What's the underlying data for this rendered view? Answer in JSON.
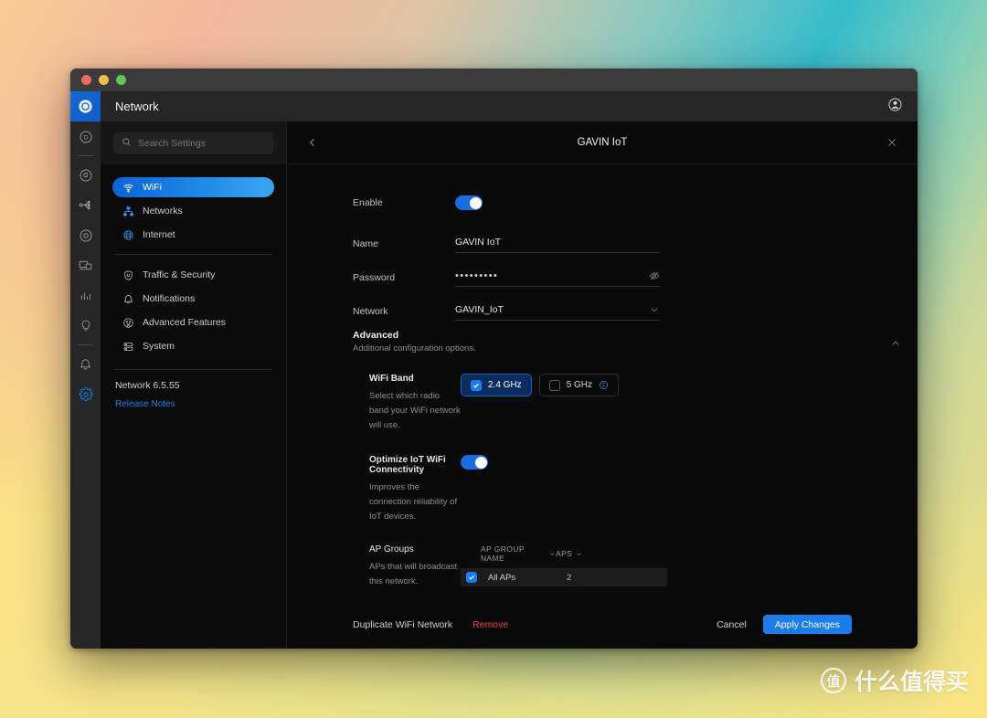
{
  "desktop": {
    "watermark_badge": "值",
    "watermark_text": "什么值得买"
  },
  "window": {
    "traffic_lights": [
      "close",
      "minimize",
      "maximize"
    ],
    "app_title": "Network"
  },
  "rail": {
    "items": [
      {
        "name": "unifi-logo",
        "label": "UniFi"
      },
      {
        "name": "console-d",
        "label": "D"
      },
      {
        "name": "divider-1",
        "label": ""
      },
      {
        "name": "network-app",
        "label": "Network"
      },
      {
        "name": "topology",
        "label": "Topology"
      },
      {
        "name": "protect-app",
        "label": "Protect"
      },
      {
        "name": "devices",
        "label": "Devices"
      },
      {
        "name": "insights",
        "label": "Insights"
      },
      {
        "name": "innovation",
        "label": "Innovation"
      },
      {
        "name": "divider-2",
        "label": ""
      },
      {
        "name": "notifications",
        "label": "Notifications"
      },
      {
        "name": "settings",
        "label": "Settings"
      }
    ]
  },
  "sidebar": {
    "search": {
      "placeholder": "Search Settings",
      "value": ""
    },
    "primary_items": [
      {
        "label": "WiFi",
        "icon": "wifi-icon",
        "active": true
      },
      {
        "label": "Networks",
        "icon": "networks-icon",
        "active": false
      },
      {
        "label": "Internet",
        "icon": "internet-icon",
        "active": false
      }
    ],
    "secondary_items": [
      {
        "label": "Traffic & Security",
        "icon": "shield-icon"
      },
      {
        "label": "Notifications",
        "icon": "bell-icon"
      },
      {
        "label": "Advanced Features",
        "icon": "advanced-icon"
      },
      {
        "label": "System",
        "icon": "system-icon"
      }
    ],
    "version": "Network 6.5.55",
    "release_notes": "Release Notes"
  },
  "detail": {
    "title": "GAVIN IoT",
    "back_icon": "chevron-left-icon",
    "close_icon": "close-icon",
    "fields": [
      {
        "label": "Enable",
        "type": "toggle",
        "value": "on"
      },
      {
        "label": "Name",
        "type": "text",
        "value": "GAVIN IoT"
      },
      {
        "label": "Password",
        "type": "password",
        "value": "•••••••••",
        "trail_icon": "eye-off-icon"
      },
      {
        "label": "Network",
        "type": "select",
        "value": "GAVIN_IoT",
        "trail_icon": "chevron-down-icon"
      }
    ],
    "advanced": {
      "title": "Advanced",
      "subtitle": "Additional configuration options.",
      "collapse_icon": "chevron-up-icon",
      "wifi_band": {
        "title": "WiFi Band",
        "description": "Select which radio band your WiFi network will use.",
        "options": [
          {
            "label": "2.4 GHz",
            "checked": true,
            "info": false
          },
          {
            "label": "5 GHz",
            "checked": false,
            "info": true
          }
        ]
      },
      "optimize_iot": {
        "title": "Optimize IoT WiFi Connectivity",
        "description": "Improves the connection reliability of IoT devices.",
        "value": "on"
      },
      "ap_groups": {
        "title": "AP Groups",
        "description": "APs that will broadcast this network.",
        "columns": [
          "AP GROUP NAME",
          "APS"
        ],
        "rows": [
          {
            "checked": true,
            "name": "All APs",
            "aps": "2"
          }
        ]
      }
    },
    "footer": {
      "duplicate": "Duplicate WiFi Network",
      "remove": "Remove",
      "cancel": "Cancel",
      "apply": "Apply Changes"
    }
  },
  "colors": {
    "accent_blue": "#1b7ceb",
    "danger_red": "#e8413a",
    "panel_bg": "#0a0a0a",
    "rail_bg": "#262626"
  }
}
